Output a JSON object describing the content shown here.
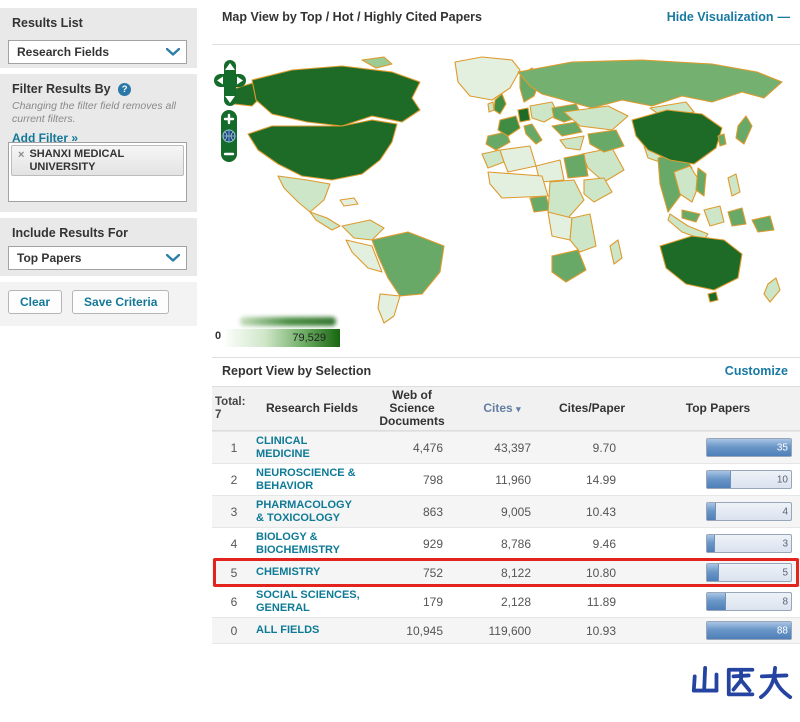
{
  "sidebar": {
    "results_list": {
      "heading": "Results List",
      "selected": "Research Fields"
    },
    "filter": {
      "heading": "Filter Results By",
      "help_symbol": "?",
      "note": "Changing the filter field removes all current filters.",
      "add_filter_label": "Add Filter »",
      "active_filters": [
        {
          "remove_symbol": "×",
          "label": "SHANXI MEDICAL UNIVERSITY"
        }
      ]
    },
    "include_results": {
      "heading": "Include Results For",
      "selected": "Top Papers"
    },
    "actions": {
      "clear_label": "Clear",
      "save_label": "Save Criteria"
    }
  },
  "map_section": {
    "title": "Map View by Top / Hot / Highly Cited Papers",
    "hide_link_label": "Hide Visualization",
    "hide_link_symbol": "—",
    "legend": {
      "min": "0",
      "max": "79,529"
    }
  },
  "report": {
    "title": "Report View by Selection",
    "customize_label": "Customize",
    "total_label": "Total:",
    "total_value": "7",
    "columns": [
      "Research Fields",
      "Web of Science Documents",
      "Cites",
      "Cites/Paper",
      "Top Papers"
    ],
    "sort_arrow": "▾",
    "rows": [
      {
        "rank": "1",
        "field": "CLINICAL MEDICINE",
        "docs": "4,476",
        "cites": "43,397",
        "cites_per_paper": "9.70",
        "top_papers": "35",
        "bar_pct": 100
      },
      {
        "rank": "2",
        "field": "NEUROSCIENCE & BEHAVIOR",
        "docs": "798",
        "cites": "11,960",
        "cites_per_paper": "14.99",
        "top_papers": "10",
        "bar_pct": 29
      },
      {
        "rank": "3",
        "field": "PHARMACOLOGY & TOXICOLOGY",
        "docs": "863",
        "cites": "9,005",
        "cites_per_paper": "10.43",
        "top_papers": "4",
        "bar_pct": 11
      },
      {
        "rank": "4",
        "field": "BIOLOGY & BIOCHEMISTRY",
        "docs": "929",
        "cites": "8,786",
        "cites_per_paper": "9.46",
        "top_papers": "3",
        "bar_pct": 9
      },
      {
        "rank": "5",
        "field": "CHEMISTRY",
        "docs": "752",
        "cites": "8,122",
        "cites_per_paper": "10.80",
        "top_papers": "5",
        "bar_pct": 14,
        "highlighted": true
      },
      {
        "rank": "6",
        "field": "SOCIAL SCIENCES, GENERAL",
        "docs": "179",
        "cites": "2,128",
        "cites_per_paper": "11.89",
        "top_papers": "8",
        "bar_pct": 23
      },
      {
        "rank": "0",
        "field": "ALL FIELDS",
        "docs": "10,945",
        "cites": "119,600",
        "cites_per_paper": "10.93",
        "top_papers": "88",
        "bar_pct": 100
      }
    ]
  },
  "watermark": {
    "text": "山医大"
  },
  "colors": {
    "link_teal": "#137897",
    "highlight_red": "#e3231d",
    "map_dark_green": "#1e6b28",
    "map_medium_green": "#68a967",
    "map_light_green": "#cde6c8",
    "map_border_orange": "#dd9b2e",
    "bar_blue": "#4e7fb8",
    "watermark_blue": "#2543a0"
  }
}
